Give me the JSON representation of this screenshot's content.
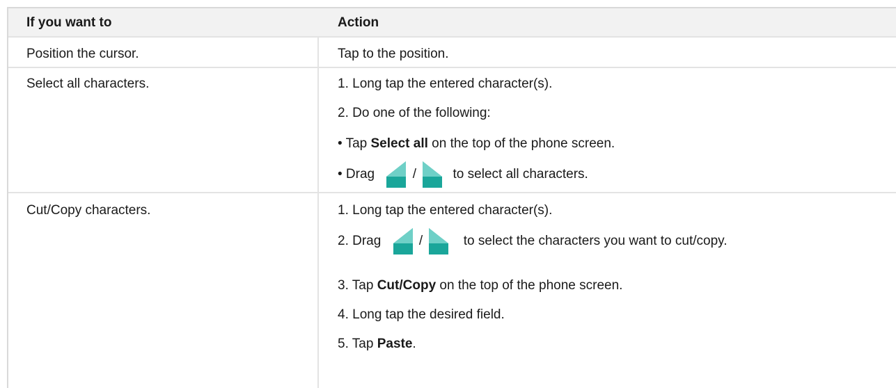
{
  "header": {
    "col1": "If you want to",
    "col2": "Action"
  },
  "rows": [
    {
      "task": "Position the cursor.",
      "steps": [
        "Tap to the position."
      ]
    },
    {
      "task": "Select all characters.",
      "step1": "1. Long tap the entered character(s).",
      "step2": "2. Do one of the following:",
      "step3_pre": "• Tap ",
      "step3_bold": "Select all",
      "step3_post": " on the top of the phone screen.",
      "step4_pre": "• Drag",
      "step4_sep": "/",
      "step4_post": "to select all characters."
    },
    {
      "task": "Cut/Copy characters.",
      "step1": "1. Long tap the entered character(s).",
      "step2_pre": "2. Drag",
      "step2_sep": "/",
      "step2_post": "to select the characters you want to cut/copy.",
      "step3_pre": "3. Tap ",
      "step3_bold": "Cut/Copy",
      "step3_post": " on the top of the phone screen.",
      "step4": "4. Long tap the desired field.",
      "step5_pre": "5. Tap ",
      "step5_bold": "Paste",
      "step5_post": "."
    }
  ],
  "icons": {
    "left_handle": "left-selection-handle-icon",
    "right_handle": "right-selection-handle-icon",
    "handle_color": "#1aa69a"
  }
}
